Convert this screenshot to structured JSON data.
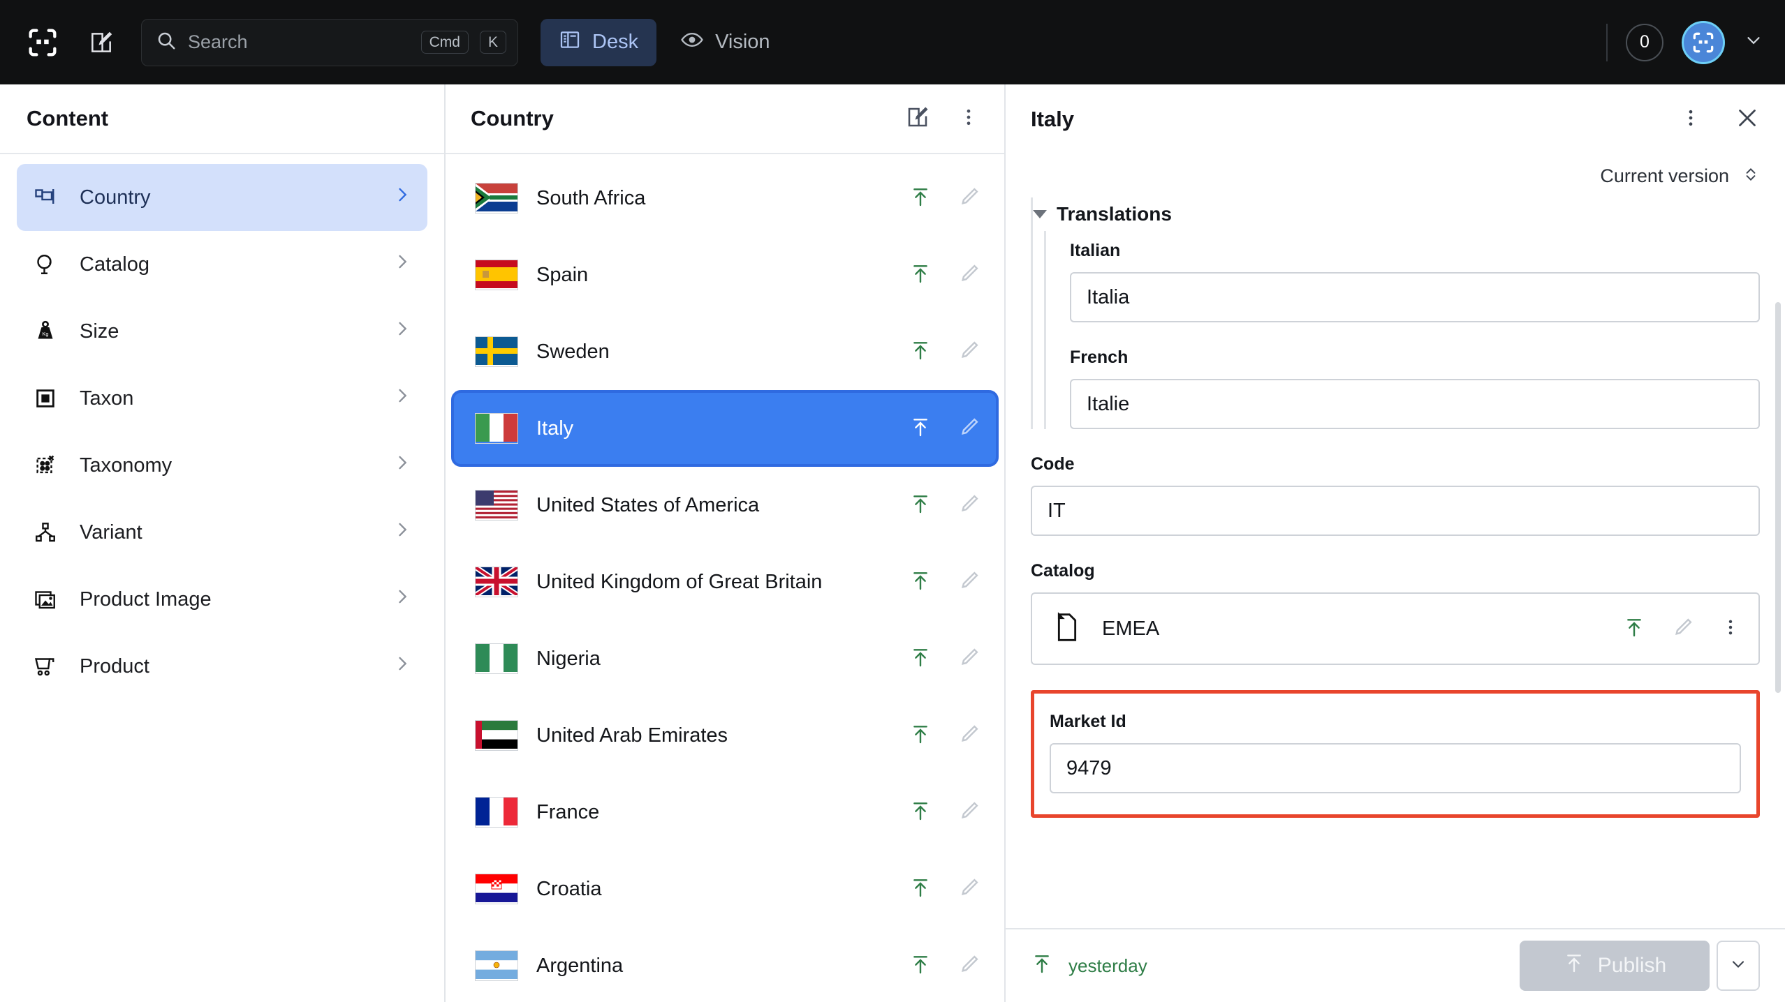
{
  "topbar": {
    "logo_icon": "studio-logo-icon",
    "compose_icon": "compose-icon",
    "search": {
      "placeholder": "Search",
      "kbd_mod": "Cmd",
      "kbd_key": "K"
    },
    "tabs": [
      {
        "label": "Desk",
        "icon": "desk-icon",
        "active": true
      },
      {
        "label": "Vision",
        "icon": "eye-icon",
        "active": false
      }
    ],
    "notification_count": "0",
    "accent_blue": "#3b7ef0"
  },
  "sidebar": {
    "title": "Content",
    "items": [
      {
        "label": "Country",
        "icon": "flag-icon",
        "active": true
      },
      {
        "label": "Catalog",
        "icon": "globe-icon",
        "active": false
      },
      {
        "label": "Size",
        "icon": "weight-icon",
        "active": false
      },
      {
        "label": "Taxon",
        "icon": "square-dot-icon",
        "active": false
      },
      {
        "label": "Taxonomy",
        "icon": "taxonomy-icon",
        "active": false
      },
      {
        "label": "Variant",
        "icon": "hierarchy-icon",
        "active": false
      },
      {
        "label": "Product Image",
        "icon": "image-icon",
        "active": false
      },
      {
        "label": "Product",
        "icon": "cart-icon",
        "active": false
      }
    ]
  },
  "list_pane": {
    "title": "Country",
    "edit_icon": "compose-icon",
    "menu_icon": "more-vertical-icon",
    "rows": [
      {
        "name": "South Africa",
        "flag": "za",
        "selected": false
      },
      {
        "name": "Spain",
        "flag": "es",
        "selected": false
      },
      {
        "name": "Sweden",
        "flag": "se",
        "selected": false
      },
      {
        "name": "Italy",
        "flag": "it",
        "selected": true
      },
      {
        "name": "United States of America",
        "flag": "us",
        "selected": false
      },
      {
        "name": "United Kingdom of Great Britain",
        "flag": "gb",
        "selected": false
      },
      {
        "name": "Nigeria",
        "flag": "ng",
        "selected": false
      },
      {
        "name": "United Arab Emirates",
        "flag": "ae",
        "selected": false
      },
      {
        "name": "France",
        "flag": "fr",
        "selected": false
      },
      {
        "name": "Croatia",
        "flag": "hr",
        "selected": false
      },
      {
        "name": "Argentina",
        "flag": "ar",
        "selected": false
      }
    ],
    "row_publish_icon": "publish-arrow-icon",
    "row_edit_icon": "pencil-icon"
  },
  "detail": {
    "title": "Italy",
    "menu_icon": "more-vertical-icon",
    "close_icon": "close-icon",
    "version_label": "Current version",
    "version_icon": "chevron-updown-icon",
    "translations": {
      "group_title": "Translations",
      "fields": [
        {
          "label": "Italian",
          "value": "Italia"
        },
        {
          "label": "French",
          "value": "Italie"
        }
      ]
    },
    "code": {
      "label": "Code",
      "value": "IT"
    },
    "catalog": {
      "label": "Catalog",
      "ref_name": "EMEA",
      "doc_icon": "document-icon",
      "publish_icon": "publish-arrow-icon",
      "edit_icon": "pencil-icon",
      "menu_icon": "more-vertical-icon"
    },
    "market_id": {
      "label": "Market Id",
      "value": "9479",
      "highlight_color": "#e8452c"
    },
    "footer": {
      "status_icon": "publish-arrow-icon",
      "status_text": "yesterday",
      "publish_label": "Publish",
      "publish_icon": "publish-arrow-icon",
      "dropdown_icon": "chevron-down-icon"
    }
  }
}
